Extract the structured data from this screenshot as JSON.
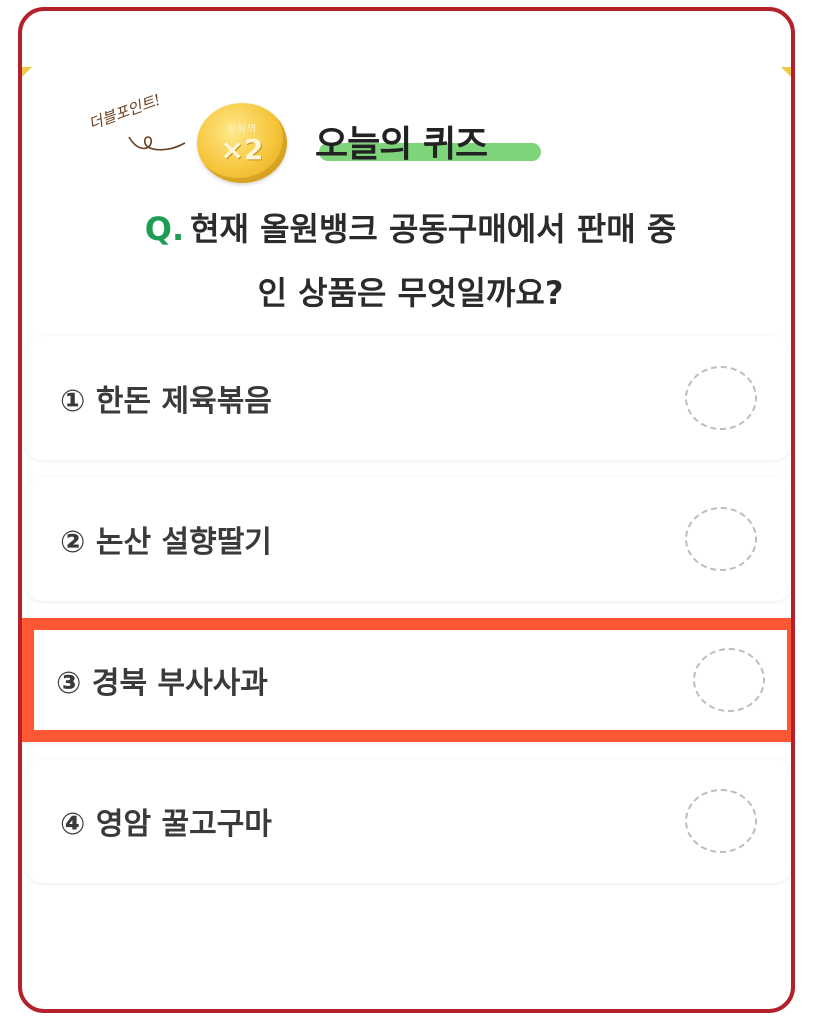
{
  "header": {
    "badge_text": "더블포인트!",
    "coin_top": "안원의",
    "coin_multiplier": "×2",
    "title": "오늘의 퀴즈"
  },
  "question": {
    "prefix": "Q.",
    "text_line1": "현재 올원뱅크 공동구매에서 판매 중",
    "text_line2": "인 상품은 무엇일까요?"
  },
  "options": [
    {
      "label": "① 한돈 제육볶음"
    },
    {
      "label": "② 논산 설향딸기"
    },
    {
      "label": "③ 경북 부사사과"
    },
    {
      "label": "④ 영암 꿀고구마"
    }
  ],
  "colors": {
    "frame": "#b3212b",
    "highlight": "#ff5733",
    "accent_green": "#1f9d55",
    "title_underline": "#7ed47a",
    "coin": "#f5c53a"
  }
}
